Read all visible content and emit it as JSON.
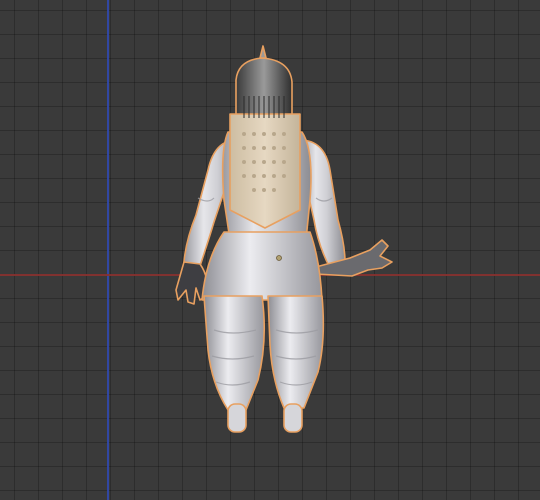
{
  "viewport": {
    "background": "#3a3a3a",
    "grid_color": "#303030",
    "axis_x_color": "#8a3230",
    "axis_y_color": "#3048a8"
  },
  "object": {
    "type": "armature-character-model",
    "icon": "3d-mesh-icon",
    "selected": true,
    "outline_color": "#e8a060",
    "body_color": "#c8c8cc",
    "backpack_color": "#d8c8b0",
    "helmet_color": "#5a5a5a"
  }
}
